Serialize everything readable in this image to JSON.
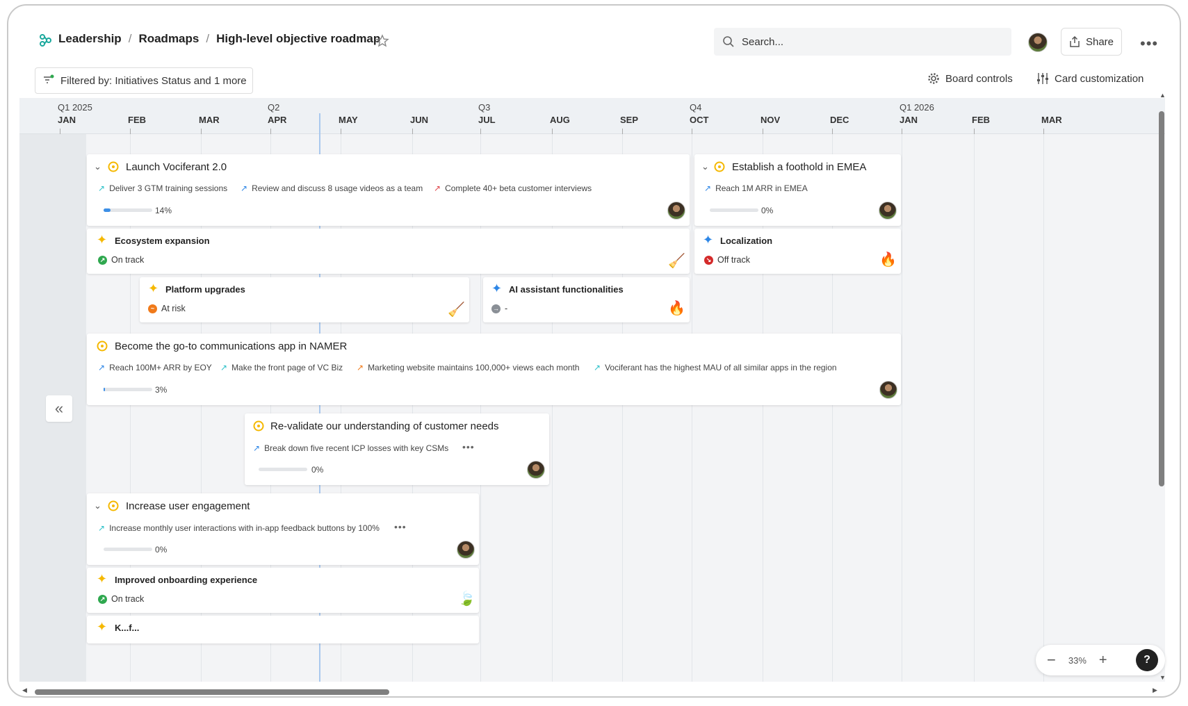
{
  "breadcrumb": {
    "items": [
      "Leadership",
      "Roadmaps",
      "High-level objective roadmap"
    ],
    "separator": "/"
  },
  "search": {
    "placeholder": "Search..."
  },
  "header": {
    "share_label": "Share"
  },
  "toolbar": {
    "filter_label": "Filtered by: Initiatives Status and 1 more",
    "board_controls_label": "Board controls",
    "card_customization_label": "Card customization"
  },
  "timeline": {
    "quarters": [
      "Q1 2025",
      "Q2",
      "Q3",
      "Q4",
      "Q1 2026"
    ],
    "months": [
      "JAN",
      "FEB",
      "MAR",
      "APR",
      "MAY",
      "JUN",
      "JUL",
      "AUG",
      "SEP",
      "OCT",
      "NOV",
      "DEC",
      "JAN",
      "FEB",
      "MAR"
    ]
  },
  "objectives": [
    {
      "title": "Launch Vociferant 2.0",
      "key_results": [
        "Deliver 3 GTM training sessions",
        "Review and discuss 8 usage videos as a team",
        "Complete 40+ beta customer interviews"
      ],
      "progress_label": "14%",
      "progress": 0.14
    },
    {
      "title": "Establish a foothold in EMEA",
      "key_results": [
        "Reach 1M ARR in EMEA"
      ],
      "progress_label": "0%",
      "progress": 0
    },
    {
      "title": "Become the go-to communications app in NAMER",
      "key_results": [
        "Reach 100M+ ARR by EOY",
        "Make the front page of VC Biz",
        "Marketing website maintains 100,000+ views each month",
        "Vociferant has the highest MAU of all similar apps in the region"
      ],
      "progress_label": "3%",
      "progress": 0.03
    },
    {
      "title": "Re-validate our understanding of customer needs",
      "key_results": [
        "Break down five recent ICP losses with key CSMs"
      ],
      "progress_label": "0%",
      "progress": 0
    },
    {
      "title": "Increase user engagement",
      "key_results": [
        "Increase monthly user interactions with in-app feedback buttons by 100%"
      ],
      "progress_label": "0%",
      "progress": 0
    }
  ],
  "initiatives": [
    {
      "title": "Ecosystem expansion",
      "status": "On track",
      "status_color": "#2fa84f",
      "icon": "broom-icon"
    },
    {
      "title": "Localization",
      "status": "Off track",
      "status_color": "#d42a2a",
      "icon": "fire-icon"
    },
    {
      "title": "Platform upgrades",
      "status": "At risk",
      "status_color": "#f07a1a",
      "icon": "broom-icon"
    },
    {
      "title": "AI assistant functionalities",
      "status": "-",
      "status_color": "#8a8f96",
      "icon": "fire-icon"
    },
    {
      "title": "Improved onboarding experience",
      "status": "On track",
      "status_color": "#2fa84f",
      "icon": "leaf-icon"
    },
    {
      "title": "K...f...",
      "status": "",
      "status_color": "#f5b800",
      "icon": ""
    }
  ],
  "zoom": {
    "level": "33%"
  },
  "colors": {
    "objective_ring": "#f5b800",
    "initiative_star": "#f5b800",
    "initiative_star_blue": "#2d86e6",
    "progress_fill": "#3d8fe6"
  }
}
